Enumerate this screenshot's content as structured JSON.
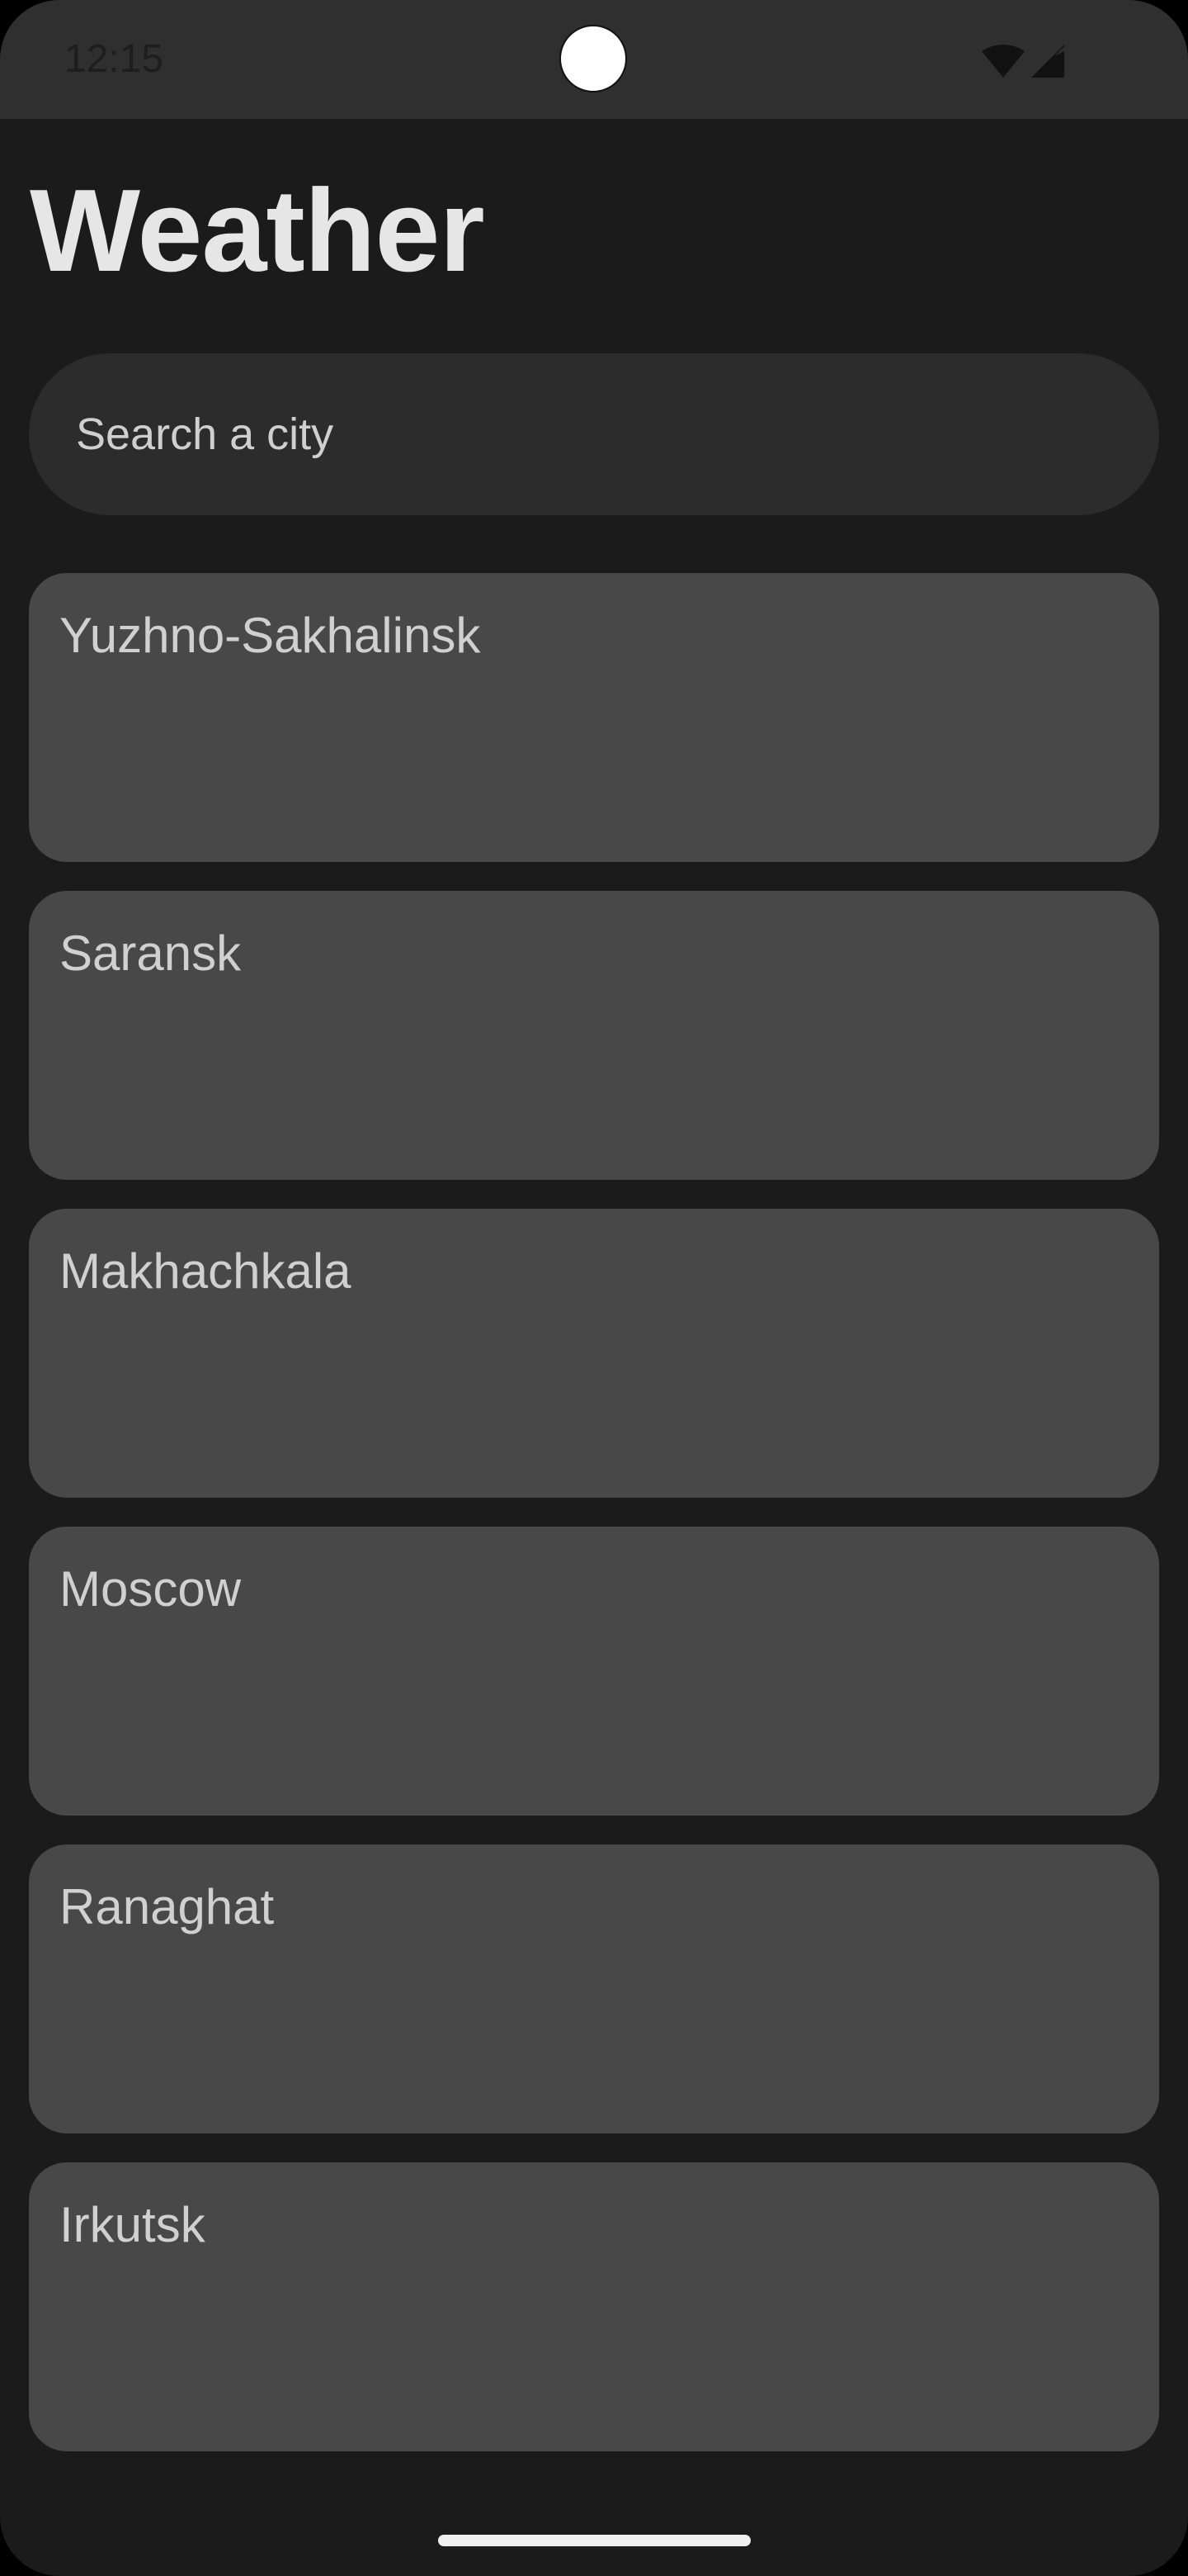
{
  "status_bar": {
    "time": "12:15",
    "icons": [
      "wifi-icon",
      "cellular-signal-icon"
    ]
  },
  "header": {
    "title": "Weather"
  },
  "search": {
    "placeholder": "Search a city",
    "value": ""
  },
  "cities": [
    {
      "name": "Yuzhno-Sakhalinsk"
    },
    {
      "name": "Saransk"
    },
    {
      "name": "Makhachkala"
    },
    {
      "name": "Moscow"
    },
    {
      "name": "Ranaghat"
    },
    {
      "name": "Irkutsk"
    }
  ],
  "colors": {
    "background": "#1b1b1b",
    "status_bar": "#2f2f2f",
    "search_field": "#2c2c2c",
    "card": "#484848",
    "title_text": "#e6e6e6",
    "card_text": "#d0d0d0"
  }
}
